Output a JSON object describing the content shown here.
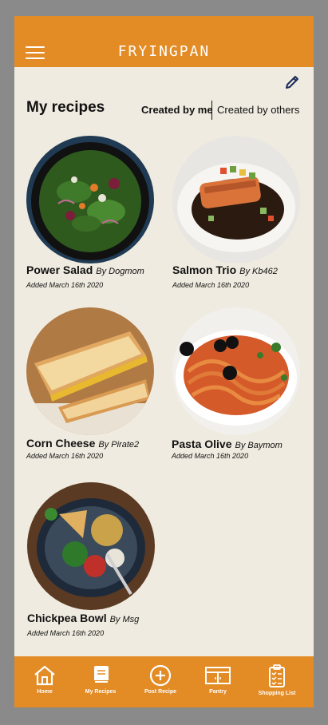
{
  "app": {
    "brand": "FRYINGPAN"
  },
  "header": {
    "menu_icon": "hamburger-menu-icon",
    "edit_icon": "pencil-edit-icon"
  },
  "page": {
    "title": "My recipes",
    "tabs": [
      {
        "label": "Created by me",
        "active": true
      },
      {
        "label": "Created by others",
        "active": false
      }
    ]
  },
  "recipes": [
    {
      "name": "Power Salad",
      "author": "By Dogmom",
      "added": "Added March 16th 2020"
    },
    {
      "name": "Salmon Trio",
      "author": "By Kb462",
      "added": "Added March 16th 2020"
    },
    {
      "name": "Corn Cheese",
      "author": "By Pirate2",
      "added": "Added March 16th 2020"
    },
    {
      "name": "Pasta Olive",
      "author": "By Baymom",
      "added": "Added March 16th 2020"
    },
    {
      "name": "Chickpea Bowl",
      "author": "By Msg",
      "added": "Added March 16th 2020"
    }
  ],
  "bottom_nav": [
    {
      "label": "Home",
      "icon": "home-icon"
    },
    {
      "label": "My Recipes",
      "icon": "recipe-book-icon"
    },
    {
      "label": "Post Recipe",
      "icon": "plus-circle-icon"
    },
    {
      "label": "Pantry",
      "icon": "pantry-cabinet-icon"
    },
    {
      "label": "Shopping List",
      "icon": "clipboard-checklist-icon"
    }
  ],
  "colors": {
    "accent": "#e38b25",
    "background": "#f0ebe0",
    "frame": "#8a8a8a"
  }
}
